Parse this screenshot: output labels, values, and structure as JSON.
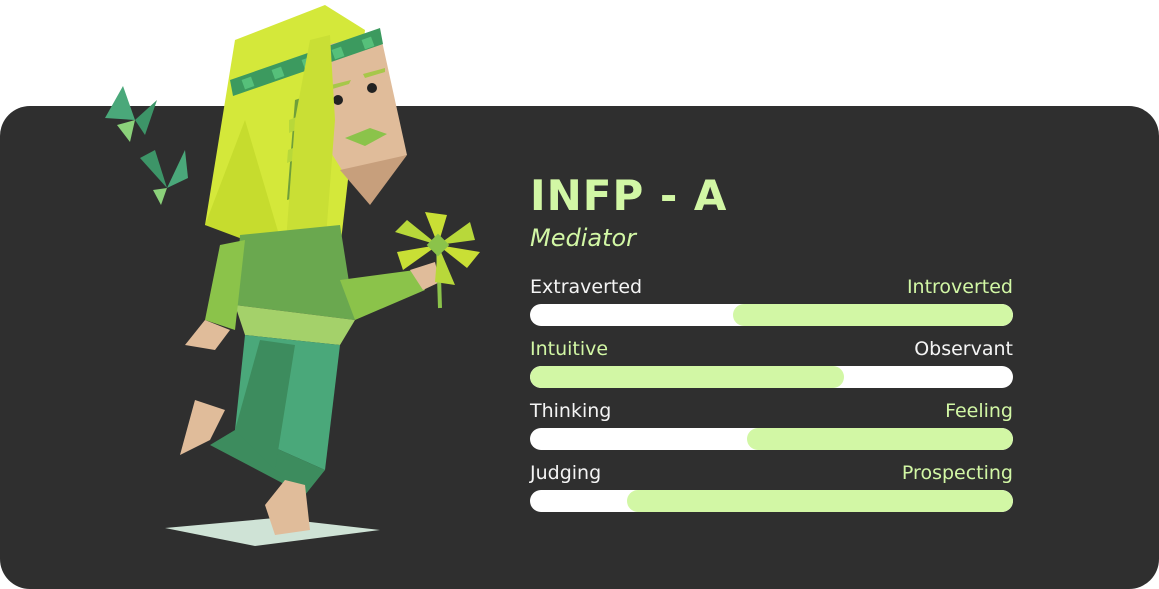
{
  "personality": {
    "code": "INFP - A",
    "name": "Mediator"
  },
  "traits": [
    {
      "left": "Extraverted",
      "right": "Introverted",
      "highlight": "right",
      "fill_start": 0.42,
      "fill_end": 1.0
    },
    {
      "left": "Intuitive",
      "right": "Observant",
      "highlight": "left",
      "fill_start": 0.0,
      "fill_end": 0.65
    },
    {
      "left": "Thinking",
      "right": "Feeling",
      "highlight": "right",
      "fill_start": 0.45,
      "fill_end": 1.0
    },
    {
      "left": "Judging",
      "right": "Prospecting",
      "highlight": "right",
      "fill_start": 0.2,
      "fill_end": 1.0
    }
  ],
  "colors": {
    "card_background": "#2f2f2f",
    "accent": "#d2f7a5",
    "bar_track": "#ffffff"
  },
  "icons": {
    "character": "mediator-character-illustration",
    "butterflies": "butterfly-icon",
    "flower": "flower-icon"
  }
}
